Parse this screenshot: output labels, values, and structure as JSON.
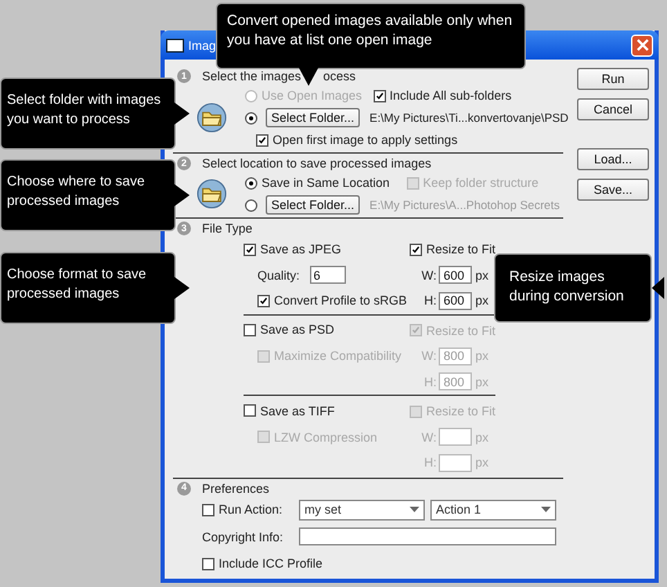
{
  "window": {
    "title": "Imag"
  },
  "buttons": [
    {
      "label": "Run"
    },
    {
      "label": "Cancel"
    },
    {
      "label": "Load..."
    },
    {
      "label": "Save..."
    }
  ],
  "source": {
    "number": "1",
    "heading_parts": [
      "Select the images",
      "ocess"
    ],
    "use_open": {
      "label": "Use Open Images",
      "selected": false,
      "disabled": true
    },
    "include_subfolders": {
      "label": "Include All sub-folders",
      "checked": true
    },
    "select_folder": {
      "label": "Select Folder...",
      "selected": true
    },
    "path": "E:\\My Pictures\\Ti...konvertovanje\\PSD",
    "open_first": {
      "label": "Open first image to apply settings",
      "checked": true
    }
  },
  "destination": {
    "number": "2",
    "heading": "Select location to save processed images",
    "same_location": {
      "label": "Save in Same Location",
      "selected": true
    },
    "keep_structure": {
      "label": "Keep folder structure",
      "checked": false,
      "disabled": true
    },
    "select_folder": {
      "label": "Select Folder...",
      "selected": false
    },
    "path": "E:\\My Pictures\\A...Photohop Secrets"
  },
  "file_type": {
    "number": "3",
    "heading": "File Type",
    "formats": [
      {
        "label": "Save as JPEG",
        "checked": true,
        "options": [
          {
            "kind": "field",
            "label": "Quality:",
            "value": "6"
          },
          {
            "kind": "checkbox",
            "label": "Convert Profile to sRGB",
            "checked": true,
            "disabled": false
          }
        ],
        "resize": {
          "label": "Resize to Fit",
          "checked": true,
          "disabled": false
        },
        "w": {
          "label": "W:",
          "value": "600",
          "unit": "px",
          "disabled": false
        },
        "h": {
          "label": "H:",
          "value": "600",
          "unit": "px",
          "disabled": false
        }
      },
      {
        "label": "Save as PSD",
        "checked": false,
        "options": [
          {
            "kind": "checkbox",
            "label": "Maximize Compatibility",
            "checked": false,
            "disabled": true
          }
        ],
        "resize": {
          "label": "Resize to Fit",
          "checked": true,
          "disabled": true
        },
        "w": {
          "label": "W:",
          "value": "800",
          "unit": "px",
          "disabled": true
        },
        "h": {
          "label": "H:",
          "value": "800",
          "unit": "px",
          "disabled": true
        }
      },
      {
        "label": "Save as TIFF",
        "checked": false,
        "options": [
          {
            "kind": "checkbox",
            "label": "LZW Compression",
            "checked": false,
            "disabled": true
          }
        ],
        "resize": {
          "label": "Resize to Fit",
          "checked": false,
          "disabled": true
        },
        "w": {
          "label": "W:",
          "unit": "px",
          "disabled": true
        },
        "h": {
          "label": "H:",
          "unit": "px",
          "disabled": true
        }
      }
    ]
  },
  "preferences": {
    "number": "4",
    "heading": "Preferences",
    "run_action": {
      "label": "Run Action:",
      "checked": false
    },
    "action_set": "my set",
    "action": "Action 1",
    "copyright": {
      "label": "Copyright Info:"
    },
    "icc": {
      "label": "Include ICC Profile",
      "checked": false
    }
  },
  "callouts": [
    {
      "text": "Convert opened images available only when you have at list one open image",
      "kind": "down"
    },
    {
      "text": "Select folder with images you want to process",
      "kind": "right"
    },
    {
      "text": "Choose where to save processed images",
      "kind": "right"
    },
    {
      "text": "Choose format to save processed images",
      "kind": "right"
    },
    {
      "text": "Resize images during conversion",
      "kind": "left"
    }
  ]
}
